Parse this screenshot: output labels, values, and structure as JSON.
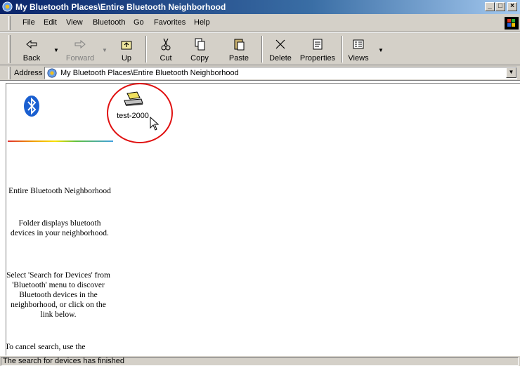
{
  "window": {
    "title": "My Bluetooth Places\\Entire Bluetooth Neighborhood"
  },
  "menu": [
    {
      "label": "File"
    },
    {
      "label": "Edit"
    },
    {
      "label": "View"
    },
    {
      "label": "Bluetooth"
    },
    {
      "label": "Go"
    },
    {
      "label": "Favorites"
    },
    {
      "label": "Help"
    }
  ],
  "toolbar": {
    "back": "Back",
    "forward": "Forward",
    "up": "Up",
    "cut": "Cut",
    "copy": "Copy",
    "paste": "Paste",
    "delete": "Delete",
    "properties": "Properties",
    "views": "Views"
  },
  "address": {
    "label": "Address",
    "value": "My Bluetooth Places\\Entire Bluetooth Neighborhood"
  },
  "left_pane": {
    "heading": "Entire Bluetooth Neighborhood",
    "description": "Folder displays bluetooth devices in your neighborhood.",
    "instructions": "Select 'Search for Devices' from 'Bluetooth' menu to discover Bluetooth devices in the neighborhood, or click on the link below.",
    "cancel_hint": "To cancel search, use the"
  },
  "devices": [
    {
      "label": "test-2000",
      "icon": "laptop-device-icon"
    }
  ],
  "status": {
    "text": "The search for devices has finished"
  },
  "colors": {
    "titlebar": "#0a246a",
    "highlight_circle": "#e01010",
    "bluetooth": "#1a5fd0"
  }
}
